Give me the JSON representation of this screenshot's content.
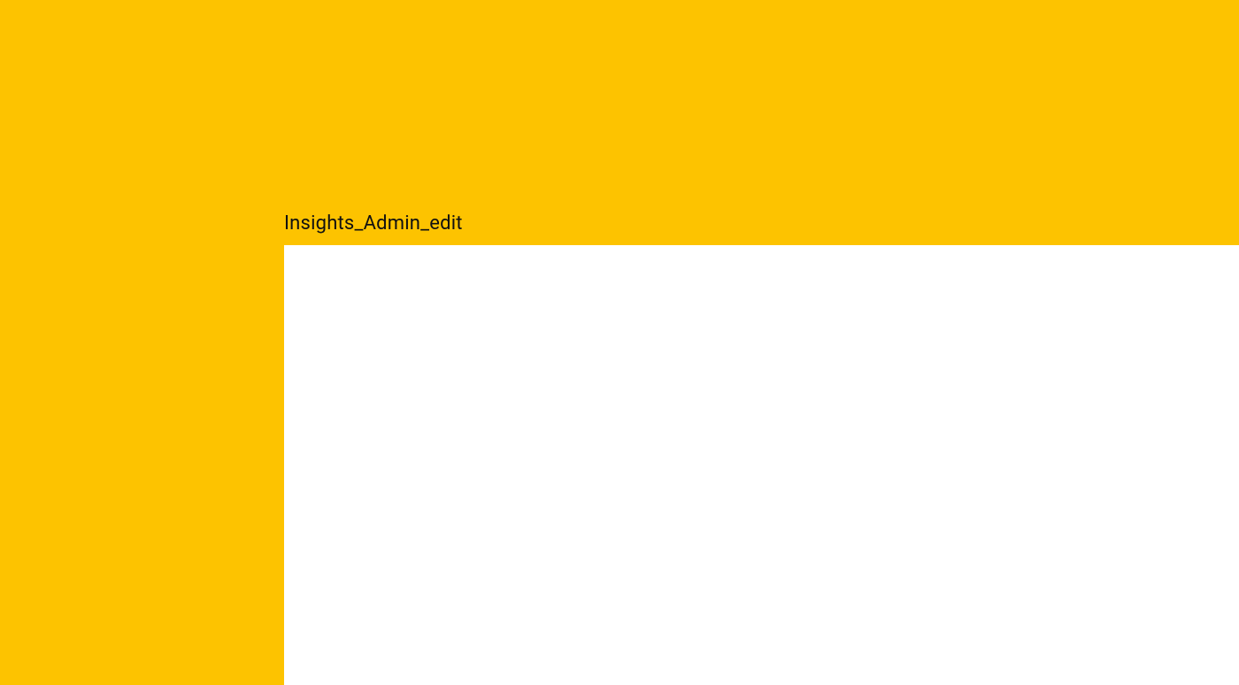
{
  "page": {
    "title": "Insights_Admin_edit"
  },
  "colors": {
    "header_bg": "#fdc300",
    "content_bg": "#ffffff",
    "title_text": "#111111"
  }
}
